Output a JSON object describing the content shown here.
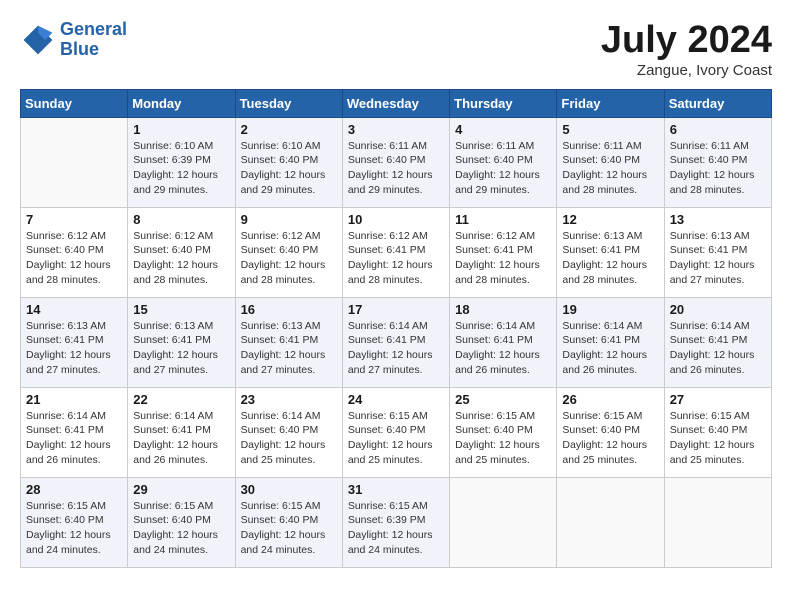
{
  "logo": {
    "text_general": "General",
    "text_blue": "Blue"
  },
  "title": "July 2024",
  "subtitle": "Zangue, Ivory Coast",
  "days_header": [
    "Sunday",
    "Monday",
    "Tuesday",
    "Wednesday",
    "Thursday",
    "Friday",
    "Saturday"
  ],
  "weeks": [
    [
      {
        "day": "",
        "info": ""
      },
      {
        "day": "1",
        "info": "Sunrise: 6:10 AM\nSunset: 6:39 PM\nDaylight: 12 hours\nand 29 minutes."
      },
      {
        "day": "2",
        "info": "Sunrise: 6:10 AM\nSunset: 6:40 PM\nDaylight: 12 hours\nand 29 minutes."
      },
      {
        "day": "3",
        "info": "Sunrise: 6:11 AM\nSunset: 6:40 PM\nDaylight: 12 hours\nand 29 minutes."
      },
      {
        "day": "4",
        "info": "Sunrise: 6:11 AM\nSunset: 6:40 PM\nDaylight: 12 hours\nand 29 minutes."
      },
      {
        "day": "5",
        "info": "Sunrise: 6:11 AM\nSunset: 6:40 PM\nDaylight: 12 hours\nand 28 minutes."
      },
      {
        "day": "6",
        "info": "Sunrise: 6:11 AM\nSunset: 6:40 PM\nDaylight: 12 hours\nand 28 minutes."
      }
    ],
    [
      {
        "day": "7",
        "info": "Sunrise: 6:12 AM\nSunset: 6:40 PM\nDaylight: 12 hours\nand 28 minutes."
      },
      {
        "day": "8",
        "info": "Sunrise: 6:12 AM\nSunset: 6:40 PM\nDaylight: 12 hours\nand 28 minutes."
      },
      {
        "day": "9",
        "info": "Sunrise: 6:12 AM\nSunset: 6:40 PM\nDaylight: 12 hours\nand 28 minutes."
      },
      {
        "day": "10",
        "info": "Sunrise: 6:12 AM\nSunset: 6:41 PM\nDaylight: 12 hours\nand 28 minutes."
      },
      {
        "day": "11",
        "info": "Sunrise: 6:12 AM\nSunset: 6:41 PM\nDaylight: 12 hours\nand 28 minutes."
      },
      {
        "day": "12",
        "info": "Sunrise: 6:13 AM\nSunset: 6:41 PM\nDaylight: 12 hours\nand 28 minutes."
      },
      {
        "day": "13",
        "info": "Sunrise: 6:13 AM\nSunset: 6:41 PM\nDaylight: 12 hours\nand 27 minutes."
      }
    ],
    [
      {
        "day": "14",
        "info": "Sunrise: 6:13 AM\nSunset: 6:41 PM\nDaylight: 12 hours\nand 27 minutes."
      },
      {
        "day": "15",
        "info": "Sunrise: 6:13 AM\nSunset: 6:41 PM\nDaylight: 12 hours\nand 27 minutes."
      },
      {
        "day": "16",
        "info": "Sunrise: 6:13 AM\nSunset: 6:41 PM\nDaylight: 12 hours\nand 27 minutes."
      },
      {
        "day": "17",
        "info": "Sunrise: 6:14 AM\nSunset: 6:41 PM\nDaylight: 12 hours\nand 27 minutes."
      },
      {
        "day": "18",
        "info": "Sunrise: 6:14 AM\nSunset: 6:41 PM\nDaylight: 12 hours\nand 26 minutes."
      },
      {
        "day": "19",
        "info": "Sunrise: 6:14 AM\nSunset: 6:41 PM\nDaylight: 12 hours\nand 26 minutes."
      },
      {
        "day": "20",
        "info": "Sunrise: 6:14 AM\nSunset: 6:41 PM\nDaylight: 12 hours\nand 26 minutes."
      }
    ],
    [
      {
        "day": "21",
        "info": "Sunrise: 6:14 AM\nSunset: 6:41 PM\nDaylight: 12 hours\nand 26 minutes."
      },
      {
        "day": "22",
        "info": "Sunrise: 6:14 AM\nSunset: 6:41 PM\nDaylight: 12 hours\nand 26 minutes."
      },
      {
        "day": "23",
        "info": "Sunrise: 6:14 AM\nSunset: 6:40 PM\nDaylight: 12 hours\nand 25 minutes."
      },
      {
        "day": "24",
        "info": "Sunrise: 6:15 AM\nSunset: 6:40 PM\nDaylight: 12 hours\nand 25 minutes."
      },
      {
        "day": "25",
        "info": "Sunrise: 6:15 AM\nSunset: 6:40 PM\nDaylight: 12 hours\nand 25 minutes."
      },
      {
        "day": "26",
        "info": "Sunrise: 6:15 AM\nSunset: 6:40 PM\nDaylight: 12 hours\nand 25 minutes."
      },
      {
        "day": "27",
        "info": "Sunrise: 6:15 AM\nSunset: 6:40 PM\nDaylight: 12 hours\nand 25 minutes."
      }
    ],
    [
      {
        "day": "28",
        "info": "Sunrise: 6:15 AM\nSunset: 6:40 PM\nDaylight: 12 hours\nand 24 minutes."
      },
      {
        "day": "29",
        "info": "Sunrise: 6:15 AM\nSunset: 6:40 PM\nDaylight: 12 hours\nand 24 minutes."
      },
      {
        "day": "30",
        "info": "Sunrise: 6:15 AM\nSunset: 6:40 PM\nDaylight: 12 hours\nand 24 minutes."
      },
      {
        "day": "31",
        "info": "Sunrise: 6:15 AM\nSunset: 6:39 PM\nDaylight: 12 hours\nand 24 minutes."
      },
      {
        "day": "",
        "info": ""
      },
      {
        "day": "",
        "info": ""
      },
      {
        "day": "",
        "info": ""
      }
    ]
  ]
}
